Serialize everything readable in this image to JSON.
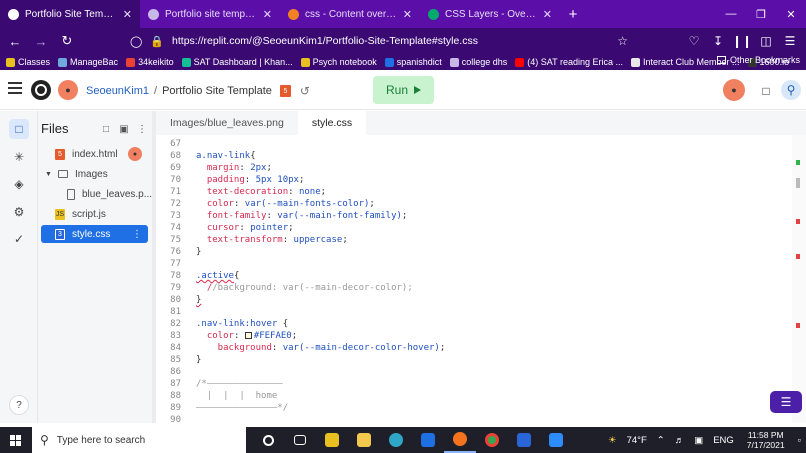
{
  "browser": {
    "tabs": [
      {
        "title": "Portfolio Site Template - Replit",
        "active": true,
        "fav_color": "#ffffff"
      },
      {
        "title": "Portfolio site template",
        "active": false,
        "fav_color": "#c8b8e8"
      },
      {
        "title": "css - Content overlapping div",
        "active": false,
        "fav_color": "#f48024"
      },
      {
        "title": "CSS Layers - Overlapping Eleme",
        "active": false,
        "fav_color": "#04aa6d"
      }
    ],
    "url": "https://replit.com/@SeoeunKim1/Portfolio-Site-Template#style.css",
    "bookmarks": [
      {
        "label": "Classes",
        "color": "#e8c020"
      },
      {
        "label": "ManageBac",
        "color": "#6fa8dc"
      },
      {
        "label": "34keikito",
        "color": "#ea4335"
      },
      {
        "label": "SAT Dashboard | Khan...",
        "color": "#14bf96"
      },
      {
        "label": "Psych notebook",
        "color": "#e8c020"
      },
      {
        "label": "spanishdict",
        "color": "#1f6fe5"
      },
      {
        "label": "college dhs",
        "color": "#c8b8e8"
      },
      {
        "label": "(4) SAT reading Erica ...",
        "color": "#ff0000"
      },
      {
        "label": "Interact Club Member ...",
        "color": "#e8e8e8"
      },
      {
        "label": "1600.io",
        "color": "#333333"
      }
    ],
    "other_bookmarks": "Other Bookmarks"
  },
  "header": {
    "user": "SeoeunKim1",
    "separator": "/",
    "project": "Portfolio Site Template",
    "run_label": "Run",
    "lang_badge": "5"
  },
  "files": {
    "title": "Files",
    "items": [
      {
        "name": "index.html",
        "type": "html",
        "indent": 0
      },
      {
        "name": "Images",
        "type": "folder",
        "indent": 0
      },
      {
        "name": "blue_leaves.p...",
        "type": "file",
        "indent": 1
      },
      {
        "name": "script.js",
        "type": "js",
        "indent": 0
      },
      {
        "name": "style.css",
        "type": "css",
        "indent": 0,
        "selected": true
      }
    ]
  },
  "editor": {
    "tabs": [
      {
        "label": "Images/blue_leaves.png",
        "active": false
      },
      {
        "label": "style.css",
        "active": true
      }
    ],
    "lines": [
      {
        "n": "67",
        "parts": []
      },
      {
        "n": "68",
        "parts": [
          {
            "t": "a.nav-link",
            "c": "sel"
          },
          {
            "t": "{",
            "c": "pun"
          }
        ]
      },
      {
        "n": "69",
        "parts": [
          {
            "t": "  margin",
            "c": "prop"
          },
          {
            "t": ": ",
            "c": "pun"
          },
          {
            "t": "2px",
            "c": "val"
          },
          {
            "t": ";",
            "c": "pun"
          }
        ]
      },
      {
        "n": "70",
        "parts": [
          {
            "t": "  padding",
            "c": "prop"
          },
          {
            "t": ": ",
            "c": "pun"
          },
          {
            "t": "5px 10px",
            "c": "val"
          },
          {
            "t": ";",
            "c": "pun"
          }
        ]
      },
      {
        "n": "71",
        "parts": [
          {
            "t": "  text-decoration",
            "c": "prop"
          },
          {
            "t": ": ",
            "c": "pun"
          },
          {
            "t": "none",
            "c": "val"
          },
          {
            "t": ";",
            "c": "pun"
          }
        ]
      },
      {
        "n": "72",
        "parts": [
          {
            "t": "  color",
            "c": "prop"
          },
          {
            "t": ": ",
            "c": "pun"
          },
          {
            "t": "var(--main-fonts-color)",
            "c": "val"
          },
          {
            "t": ";",
            "c": "pun"
          }
        ]
      },
      {
        "n": "73",
        "parts": [
          {
            "t": "  font-family",
            "c": "prop"
          },
          {
            "t": ": ",
            "c": "pun"
          },
          {
            "t": "var(--main-font-family)",
            "c": "val"
          },
          {
            "t": ";",
            "c": "pun"
          }
        ]
      },
      {
        "n": "74",
        "parts": [
          {
            "t": "  cursor",
            "c": "prop"
          },
          {
            "t": ": ",
            "c": "pun"
          },
          {
            "t": "pointer",
            "c": "val"
          },
          {
            "t": ";",
            "c": "pun"
          }
        ]
      },
      {
        "n": "75",
        "parts": [
          {
            "t": "  text-transform",
            "c": "prop"
          },
          {
            "t": ": ",
            "c": "pun"
          },
          {
            "t": "uppercase",
            "c": "val"
          },
          {
            "t": ";",
            "c": "pun"
          }
        ]
      },
      {
        "n": "76",
        "parts": [
          {
            "t": "}",
            "c": "pun"
          }
        ]
      },
      {
        "n": "77",
        "parts": []
      },
      {
        "n": "78",
        "parts": [
          {
            "t": ".active",
            "c": "sel squig"
          },
          {
            "t": "{",
            "c": "pun"
          }
        ]
      },
      {
        "n": "79",
        "parts": [
          {
            "t": "  /",
            "c": "prop"
          },
          {
            "t": "/background: var(--main-decor-color);",
            "c": "com"
          }
        ]
      },
      {
        "n": "80",
        "parts": [
          {
            "t": "}",
            "c": "pun squig"
          }
        ]
      },
      {
        "n": "81",
        "parts": []
      },
      {
        "n": "82",
        "parts": [
          {
            "t": ".nav-link:hover ",
            "c": "sel"
          },
          {
            "t": "{",
            "c": "pun"
          }
        ]
      },
      {
        "n": "83",
        "parts": [
          {
            "t": "  color",
            "c": "prop"
          },
          {
            "t": ": ",
            "c": "pun"
          },
          {
            "t": "#FEFAE0",
            "c": "val swatchval"
          },
          {
            "t": ";",
            "c": "pun"
          }
        ]
      },
      {
        "n": "84",
        "parts": [
          {
            "t": "    background",
            "c": "prop"
          },
          {
            "t": ": ",
            "c": "pun"
          },
          {
            "t": "var(--main-decor-color-hover)",
            "c": "val"
          },
          {
            "t": ";",
            "c": "pun"
          }
        ]
      },
      {
        "n": "85",
        "parts": [
          {
            "t": "}",
            "c": "pun"
          }
        ]
      },
      {
        "n": "86",
        "parts": []
      },
      {
        "n": "87",
        "parts": [
          {
            "t": "/*——————————————",
            "c": "com"
          }
        ]
      },
      {
        "n": "88",
        "parts": [
          {
            "t": "  |  |  |  home",
            "c": "com"
          }
        ]
      },
      {
        "n": "89",
        "parts": [
          {
            "t": "———————————————*/",
            "c": "com"
          }
        ]
      },
      {
        "n": "90",
        "parts": []
      }
    ]
  },
  "taskbar": {
    "search_placeholder": "Type here to search",
    "weather": "74°F",
    "lang": "ENG",
    "time": "11:58 PM",
    "date": "7/17/2021"
  }
}
